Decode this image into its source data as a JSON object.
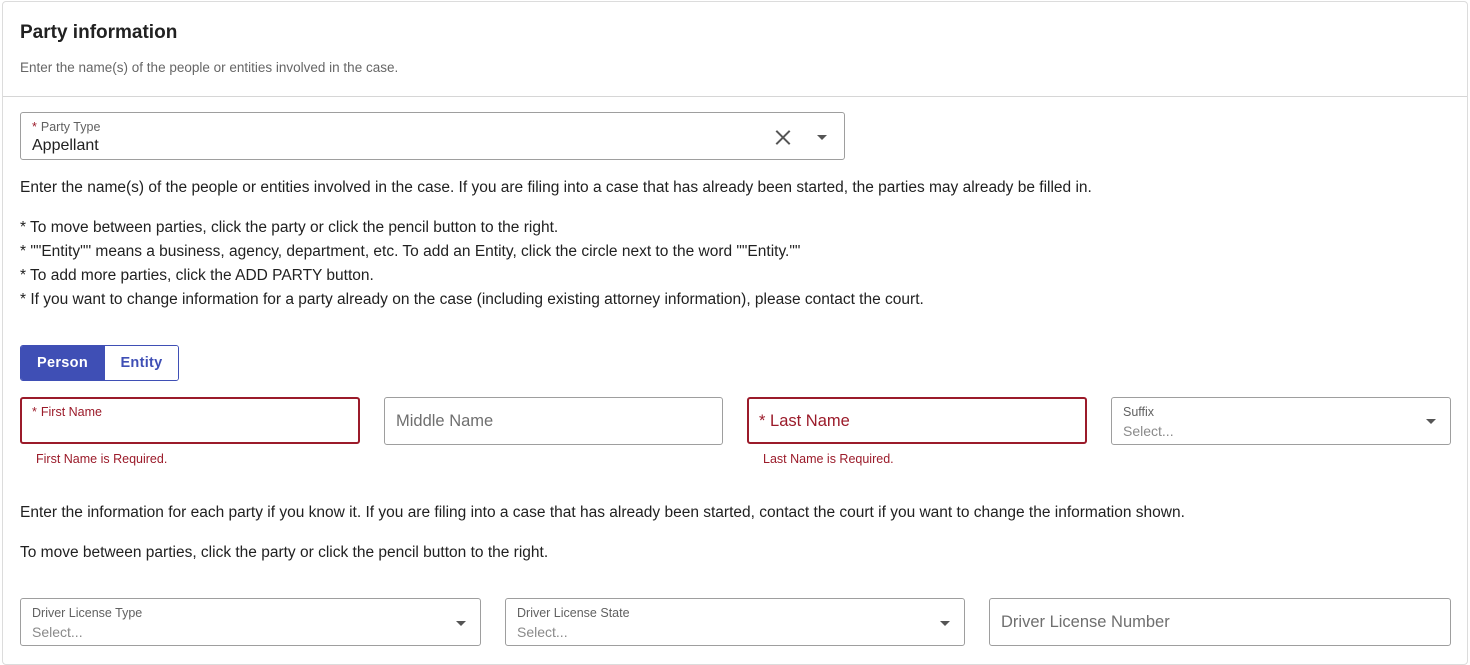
{
  "header": {
    "title": "Party information",
    "subtitle": "Enter the name(s) of the people or entities involved in the case."
  },
  "party_type": {
    "label": "Party Type",
    "required_mark": "*",
    "value": "Appellant",
    "icons": [
      "close-icon",
      "chevron-down-icon"
    ]
  },
  "intro_text": "Enter the name(s) of the people or entities involved in the case. If you are filing into a case that has already been started, the parties may already be filled in.",
  "instructions": [
    "* To move between parties, click the party or click the pencil button to the right.",
    "* \"\"Entity\"\" means a business, agency, department, etc. To add an Entity, click the circle next to the word \"\"Entity.\"\"",
    "* To add more parties, click the ADD PARTY button.",
    "* If you want to change information for a party already on the case (including existing attorney information), please contact the court."
  ],
  "party_kind_toggle": {
    "options": [
      "Person",
      "Entity"
    ],
    "selected": "Person"
  },
  "name_fields": {
    "first_name": {
      "required_mark": "*",
      "label": "First Name",
      "value": "",
      "error": "First Name is Required."
    },
    "middle_name": {
      "placeholder": "Middle Name",
      "value": ""
    },
    "last_name": {
      "required_mark": "*",
      "placeholder": "Last Name",
      "value": "",
      "error": "Last Name is Required."
    },
    "suffix": {
      "label": "Suffix",
      "placeholder": "Select..."
    }
  },
  "info_text": "Enter the information for each party if you know it. If you are filing into a case that has already been started, contact the court if you want to change the information shown.",
  "move_text": "To move between parties, click the party or click the pencil button to the right.",
  "license_fields": {
    "type": {
      "label": "Driver License Type",
      "placeholder": "Select..."
    },
    "state": {
      "label": "Driver License State",
      "placeholder": "Select..."
    },
    "number": {
      "placeholder": "Driver License Number",
      "value": ""
    }
  },
  "colors": {
    "accent": "#3f4fb5",
    "error": "#9b1b2a",
    "border": "#9e9e9e"
  }
}
